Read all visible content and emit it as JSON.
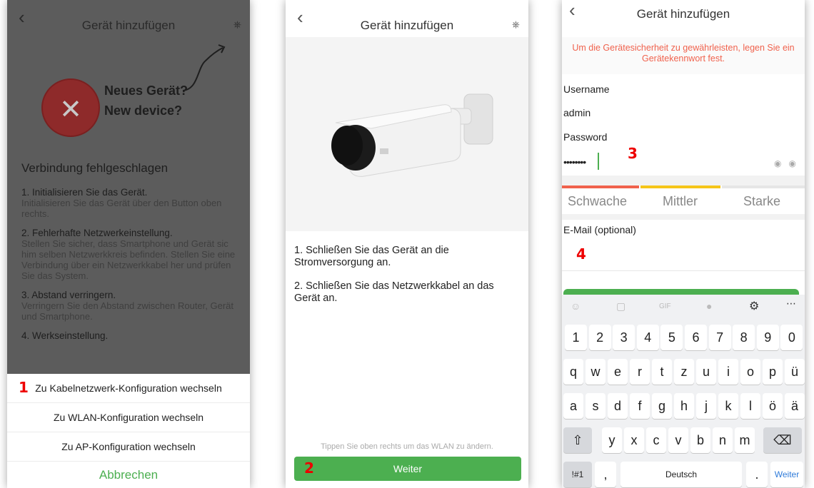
{
  "screen1": {
    "header": {
      "back_icon": "chevron-left-icon",
      "title": "Gerät hinzufügen",
      "plug_icon": "plug-icon"
    },
    "new_device": {
      "line1": "Neues Gerät?",
      "line2": "New device?"
    },
    "failure_title": "Verbindung fehlgeschlagen",
    "steps": [
      {
        "title": "1. Initialisieren Sie das Gerät.",
        "desc": "Initialisieren Sie das Gerät über den Button oben rechts."
      },
      {
        "title": "2. Fehlerhafte Netzwerkeinstellung.",
        "desc": "Stellen Sie sicher, dass Smartphone und Gerät sic him selben Netzwerkkreis befinden. Stellen Sie eine Verbindung über ein Netzwerkkabel her und prüfen Sie das System."
      },
      {
        "title": "3. Abstand verringern.",
        "desc": "Verringern Sie den Abstand zwischen Router, Gerät und Smartphone."
      },
      {
        "title": "4. Werkseinstellung.",
        "desc": ""
      }
    ],
    "sheet": {
      "option_wired": "Zu Kabelnetzwerk-Konfiguration wechseln",
      "option_wlan": "Zu WLAN-Konfiguration wechseln",
      "option_ap": "Zu AP-Konfiguration wechseln",
      "cancel": "Abbrechen"
    },
    "marker": "1"
  },
  "screen2": {
    "header": {
      "back_icon": "chevron-left-icon",
      "title": "Gerät hinzufügen",
      "plug_icon": "plug-icon"
    },
    "instructions": [
      "1. Schließen Sie das Gerät an die Stromversorgung an.",
      "2. Schließen Sie das Netzwerkkabel an das Gerät an."
    ],
    "tip": "Tippen Sie oben rechts um das WLAN zu ändern.",
    "next_button": "Weiter",
    "marker": "2"
  },
  "screen3": {
    "header": {
      "back_icon": "chevron-left-icon",
      "title": "Gerät hinzufügen"
    },
    "warning": "Um die Gerätesicherheit zu gewährleisten, legen Sie ein Gerätekennwort fest.",
    "username_label": "Username",
    "username_value": "admin",
    "password_label": "Password",
    "password_value": "••••••••",
    "strength": {
      "weak": "Schwache",
      "medium": "Mittler",
      "strong": "Starke"
    },
    "email_label": "E-Mail (optional)",
    "marker_password": "3",
    "marker_email": "4",
    "keyboard": {
      "numbers": [
        "1",
        "2",
        "3",
        "4",
        "5",
        "6",
        "7",
        "8",
        "9",
        "0"
      ],
      "row1": [
        "q",
        "w",
        "e",
        "r",
        "t",
        "z",
        "u",
        "i",
        "o",
        "p",
        "ü"
      ],
      "row2": [
        "a",
        "s",
        "d",
        "f",
        "g",
        "h",
        "j",
        "k",
        "l",
        "ö",
        "ä"
      ],
      "row3": [
        "y",
        "x",
        "c",
        "v",
        "b",
        "n",
        "m"
      ],
      "symbols": "!#1",
      "comma": ",",
      "space": "Deutsch",
      "period": ".",
      "enter": "Weiter"
    }
  },
  "colors": {
    "accent_green": "#4caf50",
    "warning_red": "#f0624d",
    "marker_red": "#ee0000"
  }
}
